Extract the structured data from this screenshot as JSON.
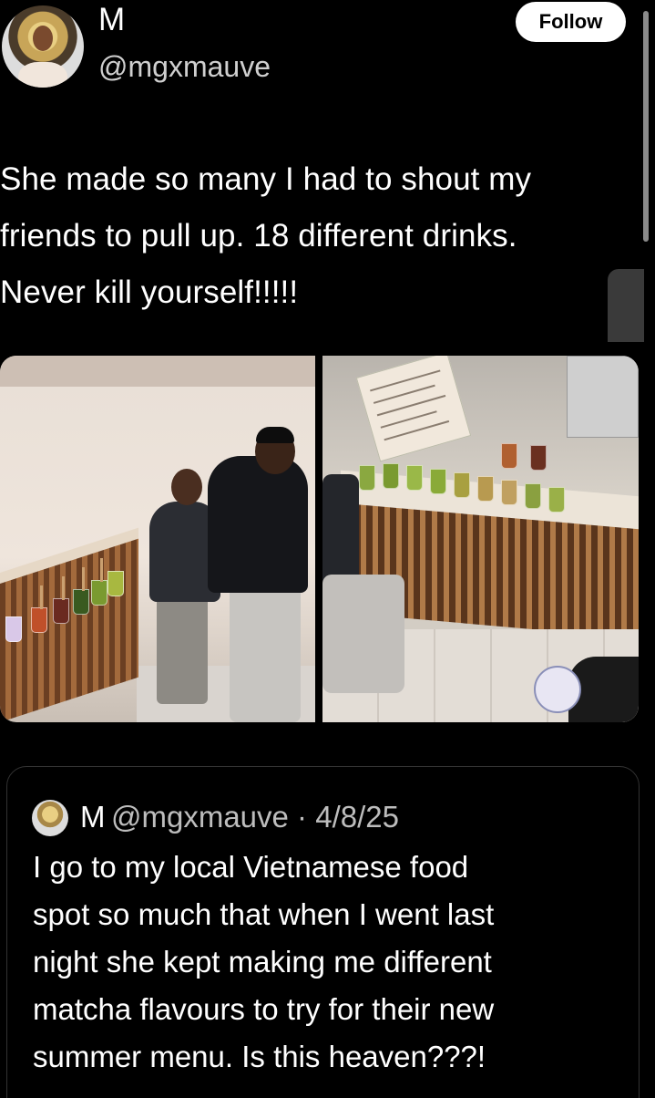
{
  "post": {
    "display_name": "M",
    "handle": "@mgxmauve",
    "follow_label": "Follow",
    "text_lines": [
      "She made so many I had to shout my",
      "friends to pull up. 18 different drinks.",
      "Never kill yourself!!!!!"
    ]
  },
  "quoted_post": {
    "display_name": "M",
    "handle_date": "@mgxmauve · 4/8/25",
    "text_lines": [
      "I go to my local Vietnamese food",
      "spot so much that when I went last",
      "night she kept making me different",
      "matcha flavours to try for their new",
      "summer menu. Is this heaven???!"
    ]
  },
  "icons": {
    "avatar": "profile-avatar",
    "quote_avatar": "profile-avatar-small"
  },
  "colors": {
    "background": "#000000",
    "text": "#ffffff",
    "secondary_text": "#cfcfcf",
    "follow_button_bg": "#ffffff"
  }
}
